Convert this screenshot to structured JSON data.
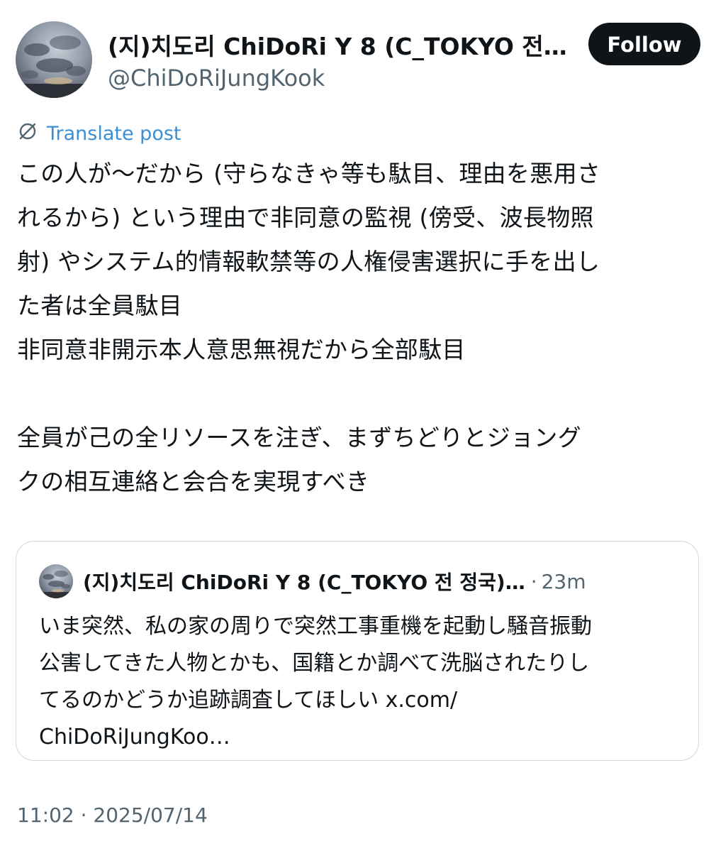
{
  "author": {
    "display_name": "(지)치도리 ChiDoRi Y 8 (C_TOKYO 전…",
    "handle": "@ChiDoRiJungKook"
  },
  "follow_button": {
    "label": "Follow"
  },
  "translate": {
    "icon": "translate-globe-icon",
    "label": "Translate post"
  },
  "post": {
    "text": "この人が〜だから (守らなきゃ等も駄目、理由を悪用さ\nれるから) という理由で非同意の監視 (傍受、波長物照\n射) やシステム的情報軟禁等の人権侵害選択に手を出し\nた者は全員駄目\n非同意非開示本人意思無視だから全部駄目\n\n全員が己の全リソースを注ぎ、まずちどりとジョング\nクの相互連絡と会合を実現すべき"
  },
  "quoted_post": {
    "display_name": "(지)치도리 ChiDoRi Y 8 (C_TOKYO 전 정국)…",
    "separator": "·",
    "time_ago": "23m",
    "text": "いま突然、私の家の周りで突然工事重機を起動し騒音振動\n公害してきた人物とかも、国籍とか調べて洗脳されたりし\nてるのかどうか追跡調査してほしい x.com/\nChiDoRiJungKoo…"
  },
  "timestamp": "11:02 · 2025/07/14",
  "colors": {
    "follow_bg": "#0f1419",
    "link": "#3c8fd4",
    "secondary_text": "#536471",
    "border": "#cfd9de"
  }
}
